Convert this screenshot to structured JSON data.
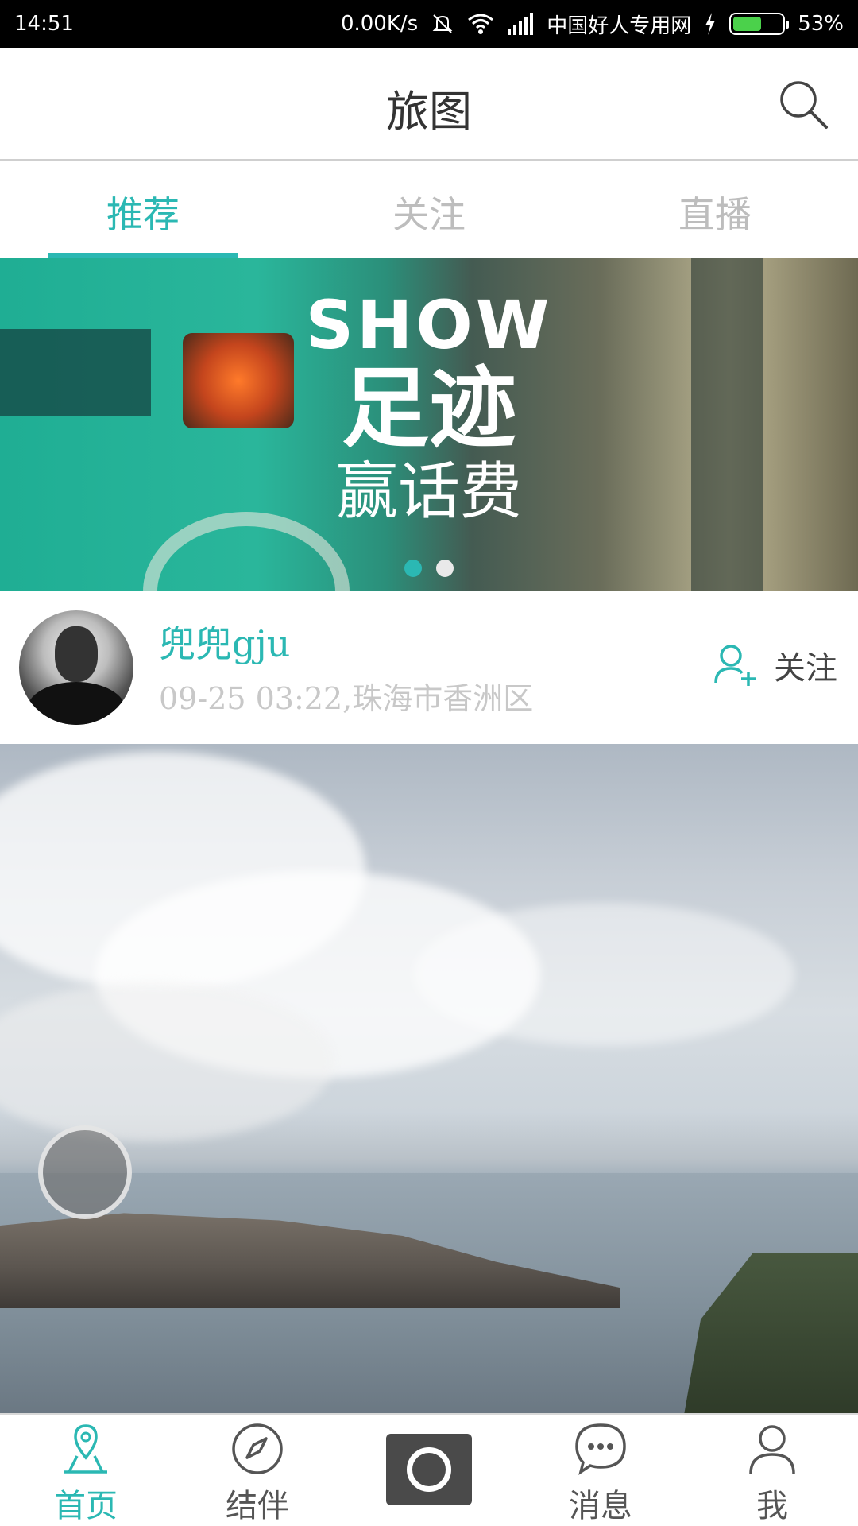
{
  "status_bar": {
    "time": "14:51",
    "network_speed": "0.00K/s",
    "carrier": "中国好人专用网",
    "battery": "53%",
    "battery_level": 0.53,
    "icons": [
      "mute-icon",
      "wifi-icon",
      "signal-icon",
      "charging-icon",
      "battery-icon"
    ]
  },
  "header": {
    "title": "旅图",
    "search_icon": "search-icon"
  },
  "tabs": [
    {
      "label": "推荐",
      "active": true
    },
    {
      "label": "关注",
      "active": false
    },
    {
      "label": "直播",
      "active": false
    }
  ],
  "banner": {
    "line1": "SHOW",
    "line2": "足迹",
    "line3": "赢话费",
    "page_count": 2,
    "active_page": 1
  },
  "post": {
    "username": "兜兜gju",
    "meta": "09-25 03:22,珠海市香洲区",
    "follow_label": "关注",
    "follow_icon": "add-user-icon"
  },
  "bottom_nav": [
    {
      "label": "首页",
      "icon": "location-pin-icon",
      "active": true
    },
    {
      "label": "结伴",
      "icon": "compass-icon",
      "active": false
    },
    {
      "label": "",
      "icon": "camera-icon",
      "active": false
    },
    {
      "label": "消息",
      "icon": "chat-bubble-icon",
      "active": false
    },
    {
      "label": "我",
      "icon": "user-icon",
      "active": false
    }
  ],
  "colors": {
    "accent": "#2bb8b3",
    "text_dark": "#333333",
    "text_muted": "#c8c8c8"
  }
}
